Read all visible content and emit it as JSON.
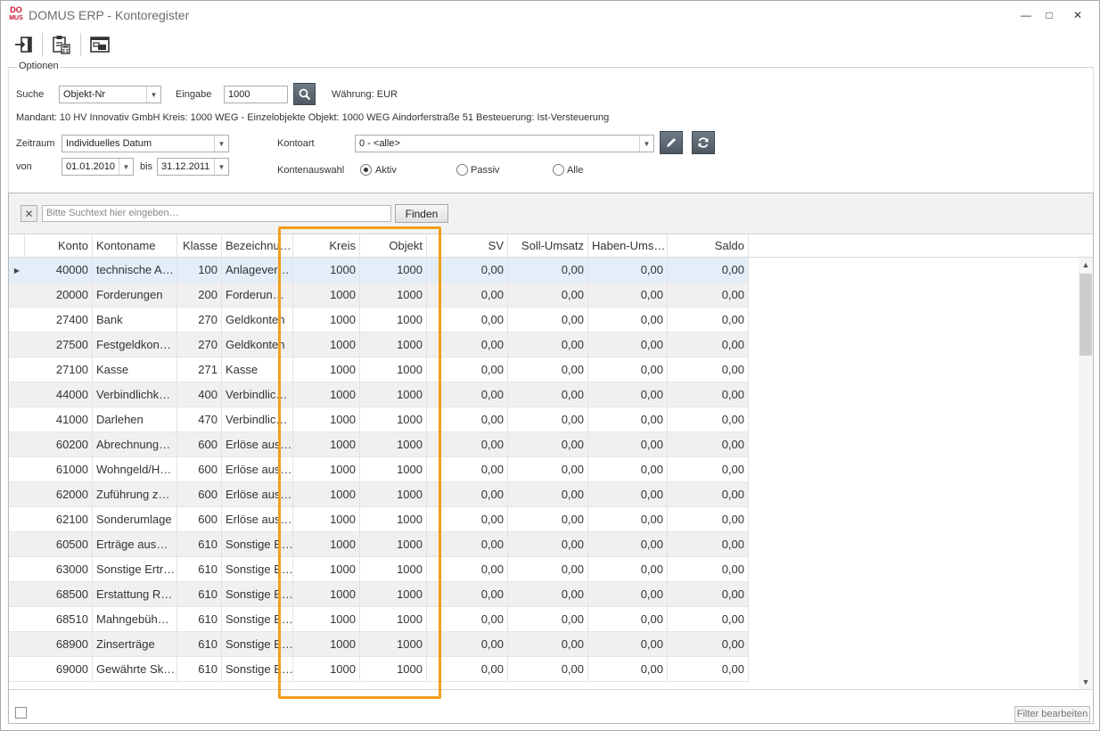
{
  "window": {
    "title": "DOMUS ERP - Kontoregister",
    "logo_top": "DO",
    "logo_bottom": "MUS",
    "controls": {
      "minimize": "—",
      "maximize": "□",
      "close": "✕"
    }
  },
  "options": {
    "legend": "Optionen",
    "suche_label": "Suche",
    "suche_value": "Objekt-Nr",
    "eingabe_label": "Eingabe",
    "eingabe_value": "1000",
    "waehrung": "Währung: EUR",
    "info_line": "Mandant: 10 HV Innovativ GmbH  Kreis: 1000 WEG - Einzelobjekte  Objekt: 1000 WEG Aindorferstraße 51  Besteuerung: Ist-Versteuerung",
    "zeitraum_label": "Zeitraum",
    "zeitraum_value": "Individuelles Datum",
    "von_label": "von",
    "von_value": "01.01.2010",
    "bis_label": "bis",
    "bis_value": "31.12.2011",
    "kontoart_label": "Kontoart",
    "kontoart_value": "0 - <alle>",
    "kontenauswahl_label": "Kontenauswahl",
    "radio_aktiv": "Aktiv",
    "radio_passiv": "Passiv",
    "radio_alle": "Alle",
    "selected_radio": "Aktiv"
  },
  "search": {
    "placeholder": "Bitte Suchtext hier eingeben…",
    "find_label": "Finden",
    "clear_label": "✕"
  },
  "grid": {
    "columns": [
      "Konto",
      "Kontoname",
      "Klasse",
      "Bezeichnu…",
      "Kreis",
      "Objekt",
      "SV",
      "Soll-Umsatz",
      "Haben-Ums…",
      "Saldo"
    ],
    "rows": [
      [
        "40000",
        "technische A…",
        "100",
        "Anlagever…",
        "1000",
        "1000",
        "0,00",
        "0,00",
        "0,00",
        "0,00"
      ],
      [
        "20000",
        "Forderungen",
        "200",
        "Forderun…",
        "1000",
        "1000",
        "0,00",
        "0,00",
        "0,00",
        "0,00"
      ],
      [
        "27400",
        "Bank",
        "270",
        "Geldkonten",
        "1000",
        "1000",
        "0,00",
        "0,00",
        "0,00",
        "0,00"
      ],
      [
        "27500",
        "Festgeldkon…",
        "270",
        "Geldkonten",
        "1000",
        "1000",
        "0,00",
        "0,00",
        "0,00",
        "0,00"
      ],
      [
        "27100",
        "Kasse",
        "271",
        "Kasse",
        "1000",
        "1000",
        "0,00",
        "0,00",
        "0,00",
        "0,00"
      ],
      [
        "44000",
        "Verbindlichk…",
        "400",
        "Verbindlic…",
        "1000",
        "1000",
        "0,00",
        "0,00",
        "0,00",
        "0,00"
      ],
      [
        "41000",
        "Darlehen",
        "470",
        "Verbindlic…",
        "1000",
        "1000",
        "0,00",
        "0,00",
        "0,00",
        "0,00"
      ],
      [
        "60200",
        "Abrechnung…",
        "600",
        "Erlöse aus…",
        "1000",
        "1000",
        "0,00",
        "0,00",
        "0,00",
        "0,00"
      ],
      [
        "61000",
        "Wohngeld/H…",
        "600",
        "Erlöse aus…",
        "1000",
        "1000",
        "0,00",
        "0,00",
        "0,00",
        "0,00"
      ],
      [
        "62000",
        "Zuführung z…",
        "600",
        "Erlöse aus…",
        "1000",
        "1000",
        "0,00",
        "0,00",
        "0,00",
        "0,00"
      ],
      [
        "62100",
        "Sonderumlage",
        "600",
        "Erlöse aus…",
        "1000",
        "1000",
        "0,00",
        "0,00",
        "0,00",
        "0,00"
      ],
      [
        "60500",
        "Erträge aus…",
        "610",
        "Sonstige E…",
        "1000",
        "1000",
        "0,00",
        "0,00",
        "0,00",
        "0,00"
      ],
      [
        "63000",
        "Sonstige Ertr…",
        "610",
        "Sonstige E…",
        "1000",
        "1000",
        "0,00",
        "0,00",
        "0,00",
        "0,00"
      ],
      [
        "68500",
        "Erstattung R…",
        "610",
        "Sonstige E…",
        "1000",
        "1000",
        "0,00",
        "0,00",
        "0,00",
        "0,00"
      ],
      [
        "68510",
        "Mahngebüh…",
        "610",
        "Sonstige E…",
        "1000",
        "1000",
        "0,00",
        "0,00",
        "0,00",
        "0,00"
      ],
      [
        "68900",
        "Zinserträge",
        "610",
        "Sonstige E…",
        "1000",
        "1000",
        "0,00",
        "0,00",
        "0,00",
        "0,00"
      ],
      [
        "69000",
        "Gewährte Sk…",
        "610",
        "Sonstige E…",
        "1000",
        "1000",
        "0,00",
        "0,00",
        "0,00",
        "0,00"
      ]
    ]
  },
  "footer": {
    "filter_button": "Filter bearbeiten"
  },
  "colors": {
    "highlight": "#f29d1b",
    "selected_row": "#e3eef9",
    "alt_row": "#f0f0f0"
  }
}
